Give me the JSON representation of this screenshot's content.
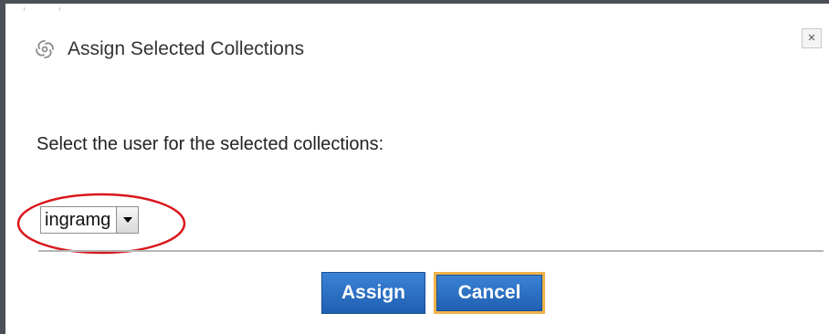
{
  "dialog": {
    "title": "Assign Selected Collections",
    "title_icon": "spiral-swirl-icon",
    "close_label": "×",
    "close_icon": "close-icon"
  },
  "form": {
    "prompt": "Select the user for the selected collections:",
    "user_select": {
      "selected_value": "ingramg",
      "arrow_icon": "chevron-down-icon"
    }
  },
  "buttons": {
    "assign_label": "Assign",
    "cancel_label": "Cancel"
  },
  "colors": {
    "button_blue": "#2b6fc4",
    "focus_orange": "#f0b24a",
    "annotation_red": "#d9161c",
    "frame_dark": "#4b4f57"
  }
}
